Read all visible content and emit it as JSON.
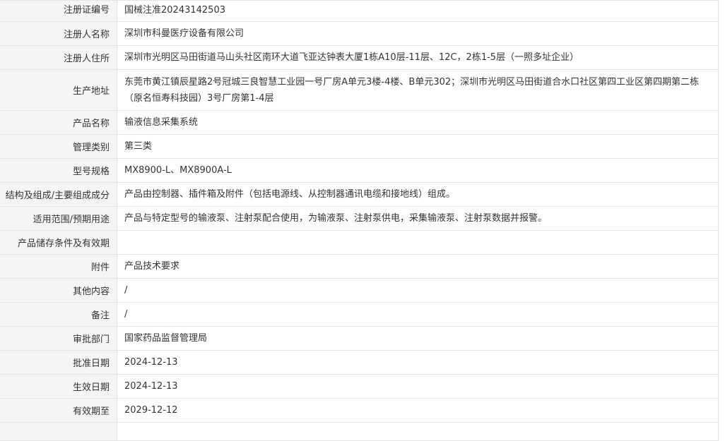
{
  "rows": [
    {
      "label": "注册证编号",
      "value": "国械注准20243142503"
    },
    {
      "label": "注册人名称",
      "value": "深圳市科曼医疗设备有限公司"
    },
    {
      "label": "注册人住所",
      "value": "深圳市光明区马田街道马山头社区南环大道飞亚达钟表大厦1栋A10层-11层、12C，2栋1-5层（一照多址企业）"
    },
    {
      "label": "生产地址",
      "value": "东莞市黄江镇辰星路2号冠城三良智慧工业园一号厂房A单元3楼-4楼、B单元302；深圳市光明区马田街道合水口社区第四工业区第四期第二栋（原名恒寿科技园）3号厂房第1-4层"
    },
    {
      "label": "产品名称",
      "value": "输液信息采集系统"
    },
    {
      "label": "管理类别",
      "value": "第三类"
    },
    {
      "label": "型号规格",
      "value": "MX8900-L、MX8900A-L"
    },
    {
      "label": "结构及组成/主要组成成分",
      "value": "产品由控制器、插件箱及附件（包括电源线、从控制器通讯电缆和接地线）组成。"
    },
    {
      "label": "适用范围/预期用途",
      "value": "产品与特定型号的输液泵、注射泵配合使用，为输液泵、注射泵供电，采集输液泵、注射泵数据并报警。"
    },
    {
      "label": "产品储存条件及有效期",
      "value": ""
    },
    {
      "label": "附件",
      "value": "产品技术要求"
    },
    {
      "label": "其他内容",
      "value": "/"
    },
    {
      "label": "备注",
      "value": "/"
    },
    {
      "label": "审批部门",
      "value": "国家药品监督管理局"
    },
    {
      "label": "批准日期",
      "value": "2024-12-13"
    },
    {
      "label": "生效日期",
      "value": "2024-12-13"
    },
    {
      "label": "有效期至",
      "value": "2029-12-12"
    },
    {
      "label": "",
      "value": ""
    }
  ]
}
